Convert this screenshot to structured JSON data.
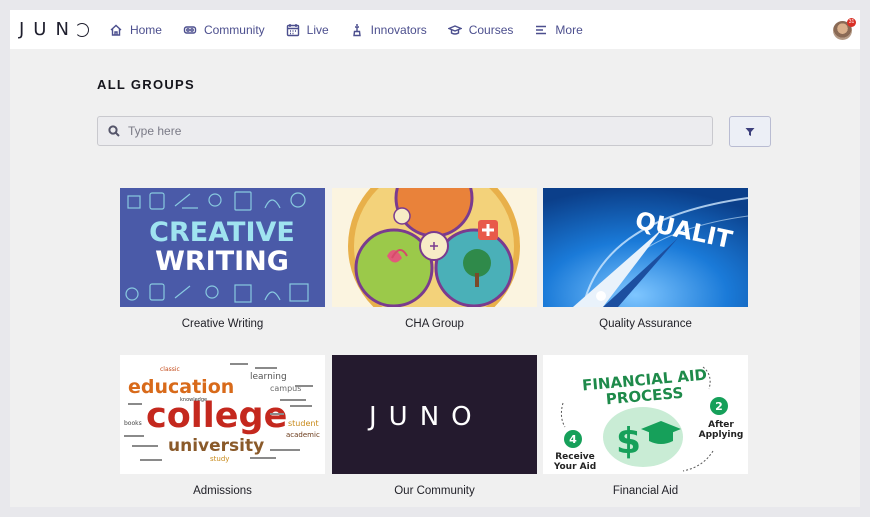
{
  "nav": {
    "logo": "JUN",
    "items": [
      {
        "label": "Home",
        "icon": "home-icon"
      },
      {
        "label": "Community",
        "icon": "community-icon"
      },
      {
        "label": "Live",
        "icon": "calendar-icon"
      },
      {
        "label": "Innovators",
        "icon": "innovators-icon"
      },
      {
        "label": "Courses",
        "icon": "graduation-cap-icon"
      },
      {
        "label": "More",
        "icon": "menu-icon"
      }
    ],
    "notification_count": "31"
  },
  "page": {
    "title": "ALL GROUPS"
  },
  "search": {
    "placeholder": "Type here",
    "value": ""
  },
  "groups": [
    {
      "name": "Creative Writing",
      "image_text": [
        "CREATIVE",
        "WRITING"
      ]
    },
    {
      "name": "CHA Group"
    },
    {
      "name": "Quality Assurance",
      "image_text": [
        "QUALIT"
      ]
    },
    {
      "name": "Admissions",
      "image_text": [
        "education",
        "college",
        "university",
        "student",
        "learning",
        "classic",
        "knowledge",
        "campus",
        "academic",
        "study",
        "books"
      ]
    },
    {
      "name": "Our Community",
      "image_text": [
        "JUNO"
      ]
    },
    {
      "name": "Financial Aid",
      "image_text": [
        "FINANCIAL AID",
        "PROCESS",
        "2",
        "After",
        "Applying",
        "4",
        "Receive",
        "Your Aid"
      ]
    }
  ],
  "colors": {
    "nav_accent": "#4c4f8e",
    "creative_bg": "#4a5aa8",
    "community_bg": "#241a2e",
    "quality_bg": "#1a7ad8",
    "financial_green": "#16a05a"
  }
}
